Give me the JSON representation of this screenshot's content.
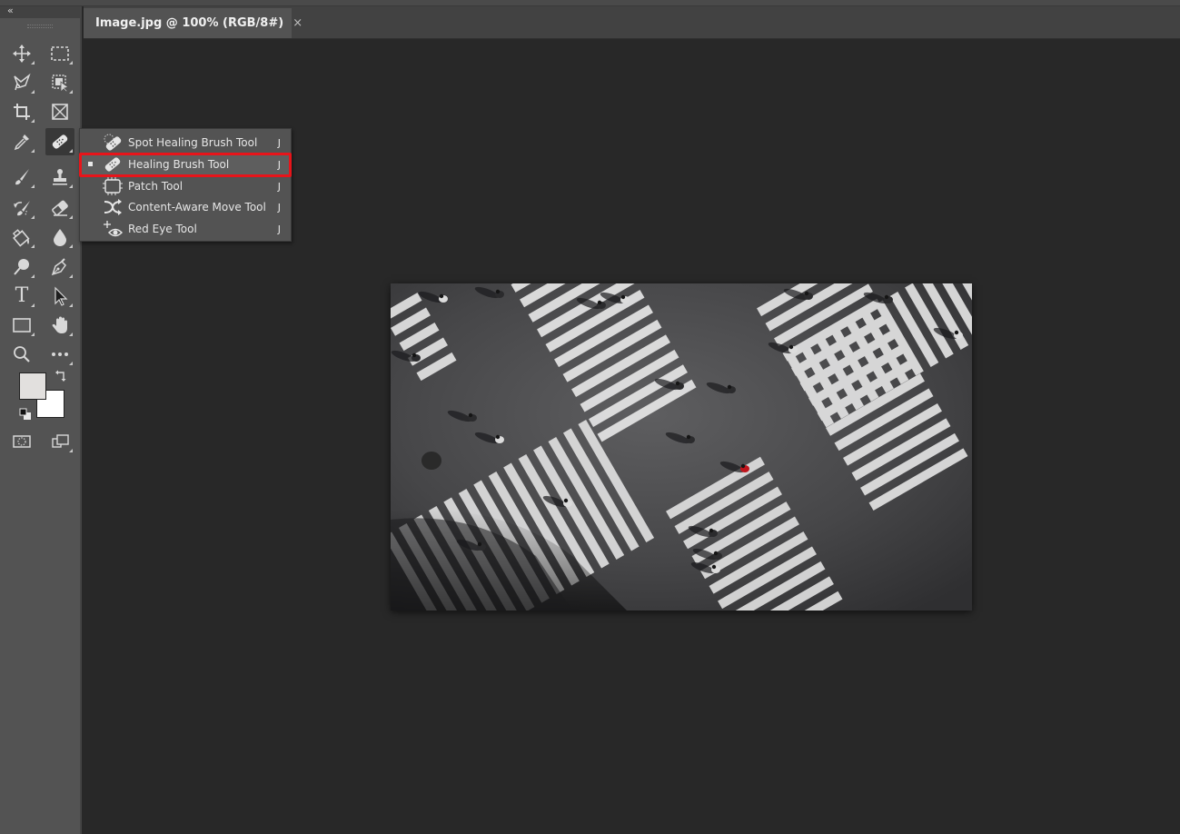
{
  "document_tab": {
    "title": "Image.jpg @ 100% (RGB/8#)",
    "close_glyph": "×"
  },
  "toolbar": {
    "collapse_glyph": "«",
    "tools": [
      {
        "name": "move-tool",
        "icon": "move-icon",
        "active": false
      },
      {
        "name": "rectangular-marquee-tool",
        "icon": "marquee-icon",
        "active": false
      },
      {
        "name": "lasso-tool",
        "icon": "lasso-icon",
        "active": false
      },
      {
        "name": "object-selection-tool",
        "icon": "object-select-icon",
        "active": false
      },
      {
        "name": "crop-tool",
        "icon": "crop-icon",
        "active": false
      },
      {
        "name": "frame-tool",
        "icon": "frame-icon",
        "active": false
      },
      {
        "name": "eyedropper-tool",
        "icon": "eyedropper-icon",
        "active": false
      },
      {
        "name": "healing-brush-tool",
        "icon": "bandage-icon",
        "active": true
      },
      {
        "name": "brush-tool",
        "icon": "brush-icon",
        "active": false
      },
      {
        "name": "clone-stamp-tool",
        "icon": "stamp-icon",
        "active": false
      },
      {
        "name": "history-brush-tool",
        "icon": "history-brush-icon",
        "active": false
      },
      {
        "name": "eraser-tool",
        "icon": "eraser-icon",
        "active": false
      },
      {
        "name": "paint-bucket-tool",
        "icon": "bucket-icon",
        "active": false
      },
      {
        "name": "blur-tool",
        "icon": "drop-icon",
        "active": false
      },
      {
        "name": "dodge-tool",
        "icon": "dodge-icon",
        "active": false
      },
      {
        "name": "pen-tool",
        "icon": "pen-icon",
        "active": false
      },
      {
        "name": "type-tool",
        "icon": "type-icon",
        "active": false
      },
      {
        "name": "path-selection-tool",
        "icon": "arrow-icon",
        "active": false
      },
      {
        "name": "rectangle-tool",
        "icon": "rectangle-icon",
        "active": false
      },
      {
        "name": "hand-tool",
        "icon": "hand-icon",
        "active": false
      },
      {
        "name": "zoom-tool",
        "icon": "magnifier-icon",
        "active": false
      },
      {
        "name": "edit-toolbar",
        "icon": "more-icon",
        "active": false
      }
    ],
    "type_glyph": "T",
    "foreground_color": "#e2e0de",
    "background_color": "#ffffff"
  },
  "flyout_menu": {
    "items": [
      {
        "label": "Spot Healing Brush Tool",
        "shortcut": "J",
        "icon": "spot-healing-icon",
        "selected": false
      },
      {
        "label": "Healing Brush Tool",
        "shortcut": "J",
        "icon": "healing-brush-icon",
        "selected": true
      },
      {
        "label": "Patch Tool",
        "shortcut": "J",
        "icon": "patch-icon",
        "selected": false
      },
      {
        "label": "Content-Aware Move Tool",
        "shortcut": "J",
        "icon": "content-aware-move-icon",
        "selected": false
      },
      {
        "label": "Red Eye Tool",
        "shortcut": "J",
        "icon": "red-eye-icon",
        "selected": false
      }
    ],
    "highlight_color": "#e8141a"
  },
  "canvas": {
    "image_description": "Aerial photo of a scramble crosswalk intersection with pedestrians",
    "background_color": "#282828"
  }
}
